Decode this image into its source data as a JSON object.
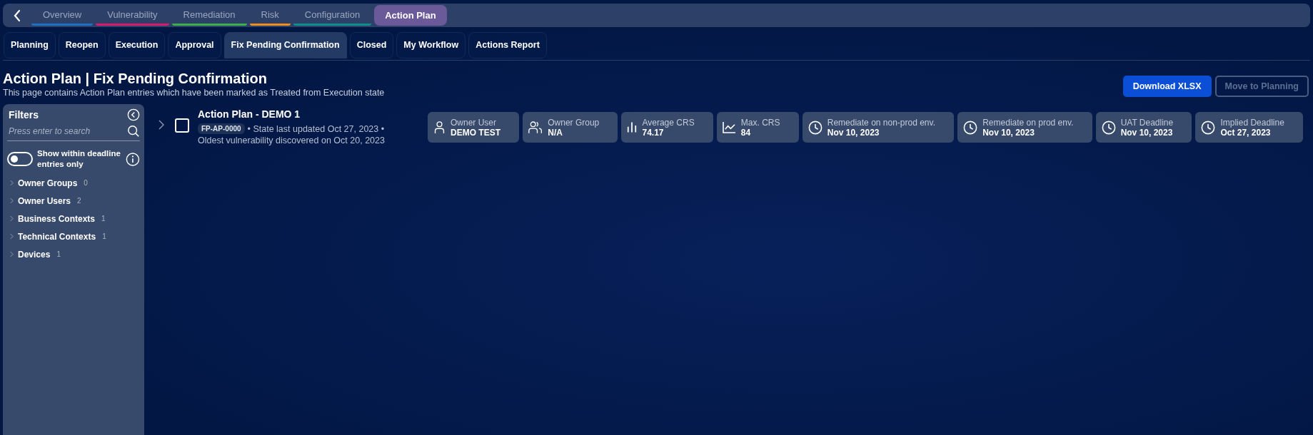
{
  "nav_tabs": [
    {
      "label": "Overview",
      "color": "#1f6fc4",
      "selected": false
    },
    {
      "label": "Vulnerability",
      "color": "#d81b6a",
      "selected": false
    },
    {
      "label": "Remediation",
      "color": "#3cae4a",
      "selected": false
    },
    {
      "label": "Risk",
      "color": "#f28c1c",
      "selected": false
    },
    {
      "label": "Configuration",
      "color": "#0f8c8c",
      "selected": false
    },
    {
      "label": "Action Plan",
      "color": "#6b5a9a",
      "selected": true
    }
  ],
  "sub_tabs": [
    {
      "label": "Planning",
      "selected": false
    },
    {
      "label": "Reopen",
      "selected": false
    },
    {
      "label": "Execution",
      "selected": false
    },
    {
      "label": "Approval",
      "selected": false
    },
    {
      "label": "Fix Pending Confirmation",
      "selected": true
    },
    {
      "label": "Closed",
      "selected": false
    },
    {
      "label": "My Workflow",
      "selected": false
    },
    {
      "label": "Actions Report",
      "selected": false
    }
  ],
  "page": {
    "title": "Action Plan | Fix Pending Confirmation",
    "subtitle": "This page contains Action Plan entries which have been marked as Treated from Execution state"
  },
  "buttons": [
    {
      "label": "Download XLSX",
      "disabled": false
    },
    {
      "label": "Move to Planning",
      "disabled": true
    }
  ],
  "filters": {
    "title": "Filters",
    "search": {
      "placeholder": "Press enter to search"
    },
    "toggle": {
      "label": "Show within deadline entries only",
      "on": false
    },
    "groups": [
      {
        "label": "Owner Groups",
        "count": "0"
      },
      {
        "label": "Owner Users",
        "count": "2"
      },
      {
        "label": "Business Contexts",
        "count": "1"
      },
      {
        "label": "Technical Contexts",
        "count": "1"
      },
      {
        "label": "Devices",
        "count": "1"
      }
    ]
  },
  "entries": [
    {
      "title": "Action Plan - DEMO 1",
      "id": "FP-AP-0000",
      "updated": "• State last updated Oct 27, 2023 •",
      "oldest": "Oldest vulnerability discovered on Oct 20, 2023",
      "checked": false,
      "cards": [
        {
          "kind": "user",
          "label": "Owner User",
          "value": "DEMO TEST"
        },
        {
          "kind": "users",
          "label": "Owner Group",
          "value": "N/A"
        },
        {
          "kind": "bars",
          "label": "Average CRS",
          "value": "74.17"
        },
        {
          "kind": "line",
          "label": "Max. CRS",
          "value": "84"
        },
        {
          "kind": "clock",
          "label": "Remediate on non-prod env.",
          "value": "Nov 10, 2023"
        },
        {
          "kind": "clock",
          "label": "Remediate on prod env.",
          "value": "Nov 10, 2023"
        },
        {
          "kind": "clock",
          "label": "UAT Deadline",
          "value": "Nov 10, 2023"
        },
        {
          "kind": "clock",
          "label": "Implied Deadline",
          "value": "Oct 27, 2023"
        }
      ]
    }
  ]
}
